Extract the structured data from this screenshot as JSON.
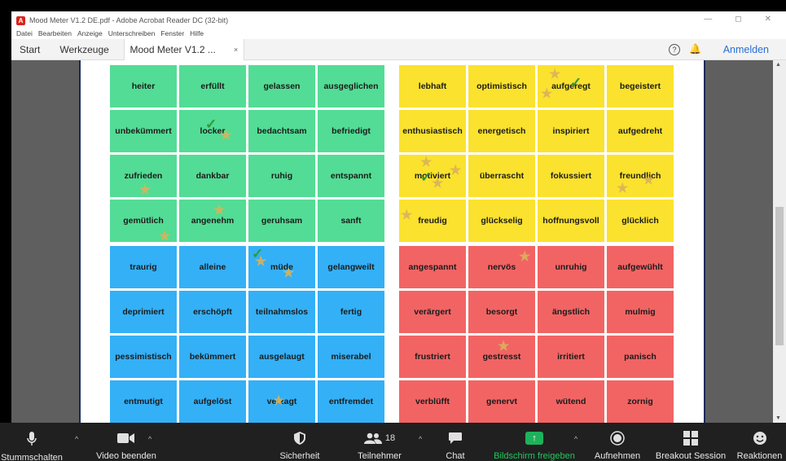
{
  "window": {
    "title": "Mood Meter V1.2 DE.pdf - Adobe Acrobat Reader DC (32-bit)",
    "controls": [
      "—",
      "◻",
      "✕"
    ]
  },
  "menu": [
    "Datei",
    "Bearbeiten",
    "Anzeige",
    "Unterschreiben",
    "Fenster",
    "Hilfe"
  ],
  "tabs": {
    "start": "Start",
    "tools": "Werkzeuge",
    "document": "Mood Meter V1.2 ...",
    "close": "×"
  },
  "header": {
    "help": "?",
    "signin": "Anmelden"
  },
  "quadrants": {
    "green": [
      "heiter",
      "erfüllt",
      "gelassen",
      "ausgeglichen",
      "unbekümmert",
      "locker",
      "bedachtsam",
      "befriedigt",
      "zufrieden",
      "dankbar",
      "ruhig",
      "entspannt",
      "gemütlich",
      "angenehm",
      "geruhsam",
      "sanft"
    ],
    "yellow": [
      "lebhaft",
      "optimistisch",
      "aufgeregt",
      "begeistert",
      "enthusiastisch",
      "energetisch",
      "inspiriert",
      "aufgedreht",
      "motiviert",
      "überrascht",
      "fokussiert",
      "freundlich",
      "freudig",
      "glückselig",
      "hoffnungsvoll",
      "glücklich"
    ],
    "blue": [
      "traurig",
      "alleine",
      "müde",
      "gelangweilt",
      "deprimiert",
      "erschöpft",
      "teilnahmslos",
      "fertig",
      "pessimistisch",
      "bekümmert",
      "ausgelaugt",
      "miserabel",
      "entmutigt",
      "aufgelöst",
      "verzagt",
      "entfremdet"
    ],
    "red": [
      "angespannt",
      "nervös",
      "unruhig",
      "aufgewühlt",
      "verärgert",
      "besorgt",
      "ängstlich",
      "mulmig",
      "frustriert",
      "gestresst",
      "irritiert",
      "panisch",
      "verblüfft",
      "genervt",
      "wütend",
      "zornig"
    ]
  },
  "annotation_glyphs": {
    "star": "★",
    "check": "✓"
  },
  "zoom_toolbar": {
    "mute": "Stummschalten",
    "video": "Video beenden",
    "security": "Sicherheit",
    "participants": "Teilnehmer",
    "participant_count": "18",
    "chat": "Chat",
    "share": "Bildschirm freigeben",
    "record": "Aufnehmen",
    "breakout": "Breakout Session",
    "reactions": "Reaktionen"
  },
  "colors": {
    "green": "#53dc95",
    "yellow": "#fbe22e",
    "blue": "#34b0f6",
    "red": "#f26464",
    "signin_blue": "#2a6fd6",
    "share_green": "#1eb15c"
  }
}
